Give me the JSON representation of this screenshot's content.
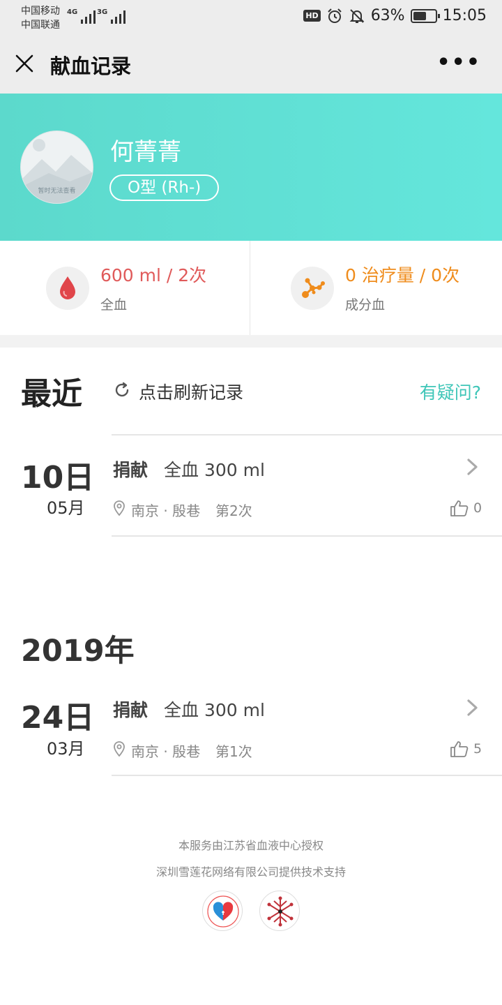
{
  "status_bar": {
    "carrier_1": "中国移动",
    "carrier_2": "中国联通",
    "network_1": "4G",
    "network_2": "3G",
    "hd": "HD",
    "battery_percent": "63%",
    "battery_level": 0.63,
    "time": "15:05"
  },
  "nav": {
    "title": "献血记录",
    "more": "•••"
  },
  "profile": {
    "avatar_text": "暂时无法查看",
    "name": "何菁菁",
    "blood_type": "O型 (Rh-)"
  },
  "stats": {
    "whole_blood": {
      "value": "600 ml / 2次",
      "label": "全血",
      "color": "#e05a5a"
    },
    "component_blood": {
      "value": "0 治疗量 / 0次",
      "label": "成分血",
      "color": "#ef8c1c"
    }
  },
  "recent": {
    "title": "最近",
    "refresh": "点击刷新记录",
    "question": "有疑问?"
  },
  "records": [
    {
      "day": "10日",
      "month": "05月",
      "kind": "捐献",
      "detail": "全血 300 ml",
      "location": "南京 · 殷巷",
      "count": "第2次",
      "likes": "0"
    },
    {
      "day": "24日",
      "month": "03月",
      "kind": "捐献",
      "detail": "全血 300 ml",
      "location": "南京 · 殷巷",
      "count": "第1次",
      "likes": "5"
    }
  ],
  "year_section": {
    "title": "2019年"
  },
  "footer": {
    "line1": "本服务由江苏省血液中心授权",
    "line2": "深圳雪莲花网络有限公司提供技术支持"
  },
  "colors": {
    "accent": "#3fc6b8",
    "header_start": "#5cd9cc",
    "header_end": "#64e6dc"
  }
}
